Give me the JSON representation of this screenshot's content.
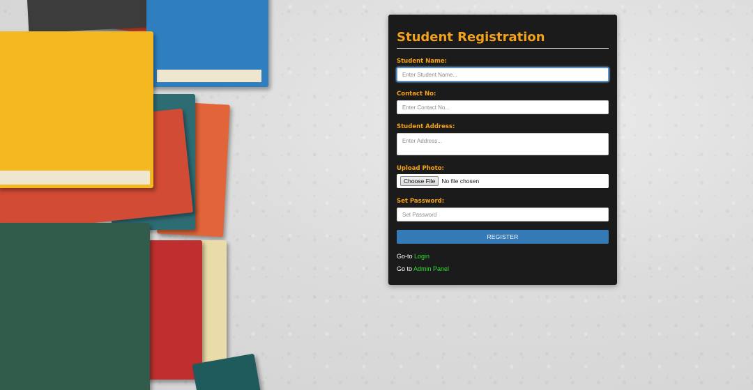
{
  "form": {
    "title": "Student Registration",
    "fields": {
      "name": {
        "label": "Student Name:",
        "placeholder": "Enter Student Name..."
      },
      "contact": {
        "label": "Contact No:",
        "placeholder": "Enter Contact No..."
      },
      "address": {
        "label": "Student Address:",
        "placeholder": "Enter Address..."
      },
      "photo": {
        "label": "Upload Photo:",
        "button_label": "Choose File",
        "status": "No file chosen"
      },
      "password": {
        "label": "Set Password:",
        "placeholder": "Set Password"
      }
    },
    "submit_label": "REGISTER",
    "links": {
      "login": {
        "prefix": "Go-to",
        "label": "Login"
      },
      "admin": {
        "prefix": "Go to",
        "label": "Admin Panel"
      }
    }
  },
  "colors": {
    "card_bg": "#1b1b1b",
    "accent": "#f5a21b",
    "button": "#337ab7",
    "link": "#2ee02e"
  }
}
